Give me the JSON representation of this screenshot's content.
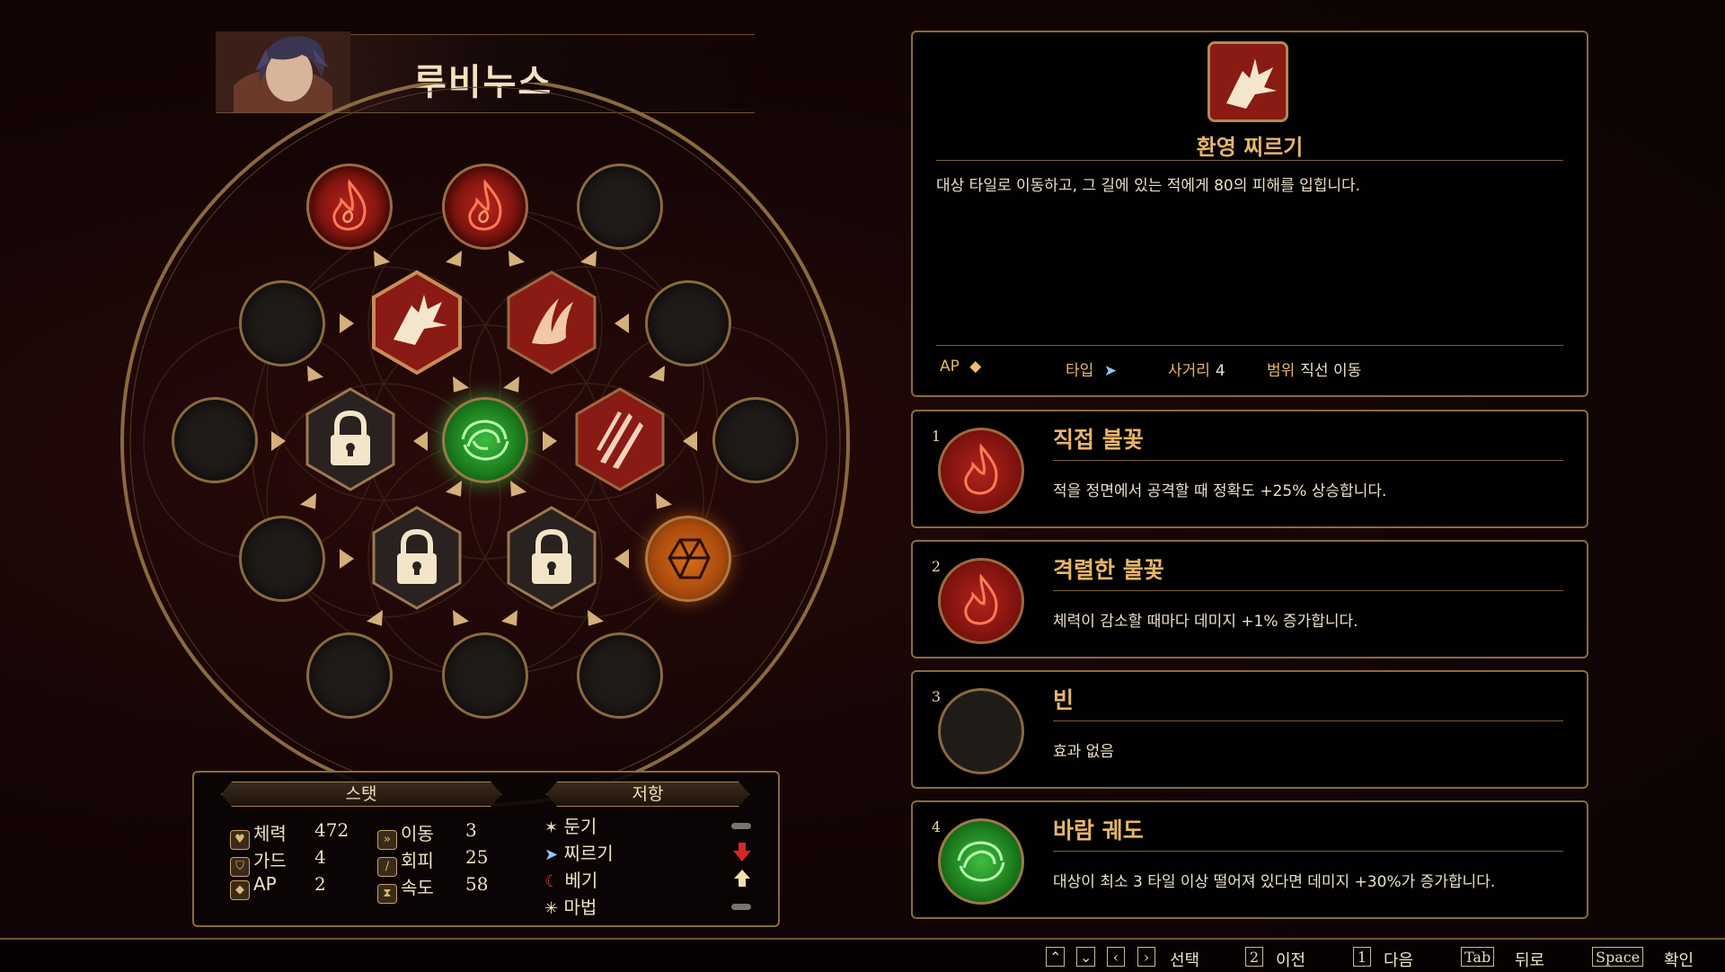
{
  "character": {
    "name": "루비누스"
  },
  "stats_panel": {
    "stat_header": "스탯",
    "resist_header": "저항",
    "stats": [
      {
        "icon": "heart-icon",
        "label": "체력",
        "value": "472"
      },
      {
        "icon": "shield-icon",
        "label": "가드",
        "value": "4"
      },
      {
        "icon": "ap-diamond-icon",
        "label": "AP",
        "value": "2"
      },
      {
        "icon": "boot-icon",
        "label": "이동",
        "value": "3"
      },
      {
        "icon": "feather-icon",
        "label": "회피",
        "value": "25"
      },
      {
        "icon": "hourglass-icon",
        "label": "속도",
        "value": "58"
      }
    ],
    "resistances": [
      {
        "icon": "blunt-icon",
        "label": "둔기",
        "indicator": "neutral"
      },
      {
        "icon": "pierce-icon",
        "label": "찌르기",
        "indicator": "weak"
      },
      {
        "icon": "slash-icon",
        "label": "베기",
        "indicator": "resist"
      },
      {
        "icon": "magic-icon",
        "label": "마법",
        "indicator": "neutral"
      }
    ]
  },
  "skill": {
    "icon": "wolf-pierce-icon",
    "title": "환영 찌르기",
    "description": "대상 타일로 이동하고, 그 길에 있는 적에게 80의 피해를 입힙니다.",
    "ap_label": "AP",
    "type_label": "타입",
    "range_label": "사거리",
    "range_value": "4",
    "area_label": "범위",
    "area_value": "직선 이동"
  },
  "runes": [
    {
      "number": "1",
      "icon": "fire-rune-icon",
      "type": "fire",
      "title": "직접 불꽃",
      "description": "적을 정면에서 공격할 때 정확도 +25% 상승합니다."
    },
    {
      "number": "2",
      "icon": "fire-rune-icon",
      "type": "fire",
      "title": "격렬한 불꽃",
      "description": "체력이 감소할 때마다 데미지 +1% 증가합니다."
    },
    {
      "number": "3",
      "icon": "empty-rune-icon",
      "type": "empty",
      "title": "빈",
      "description": "효과 없음"
    },
    {
      "number": "4",
      "icon": "wind-rune-icon",
      "type": "wind",
      "title": "바람 궤도",
      "description": "대상이 최소 3 타일 이상 떨어져 있다면 데미지 +30%가 증가합니다."
    }
  ],
  "footer": {
    "navigate_label": "선택",
    "prev_key": "2",
    "prev_label": "이전",
    "next_key": "1",
    "next_label": "다음",
    "back_key": "Tab",
    "back_label": "뒤로",
    "confirm_key": "Space",
    "confirm_label": "확인"
  },
  "colors": {
    "accent_gold": "#e6b567",
    "fire": "#b1241c",
    "wind": "#3fbd3f",
    "earth": "#d86e1a",
    "weak": "#d42a20"
  }
}
